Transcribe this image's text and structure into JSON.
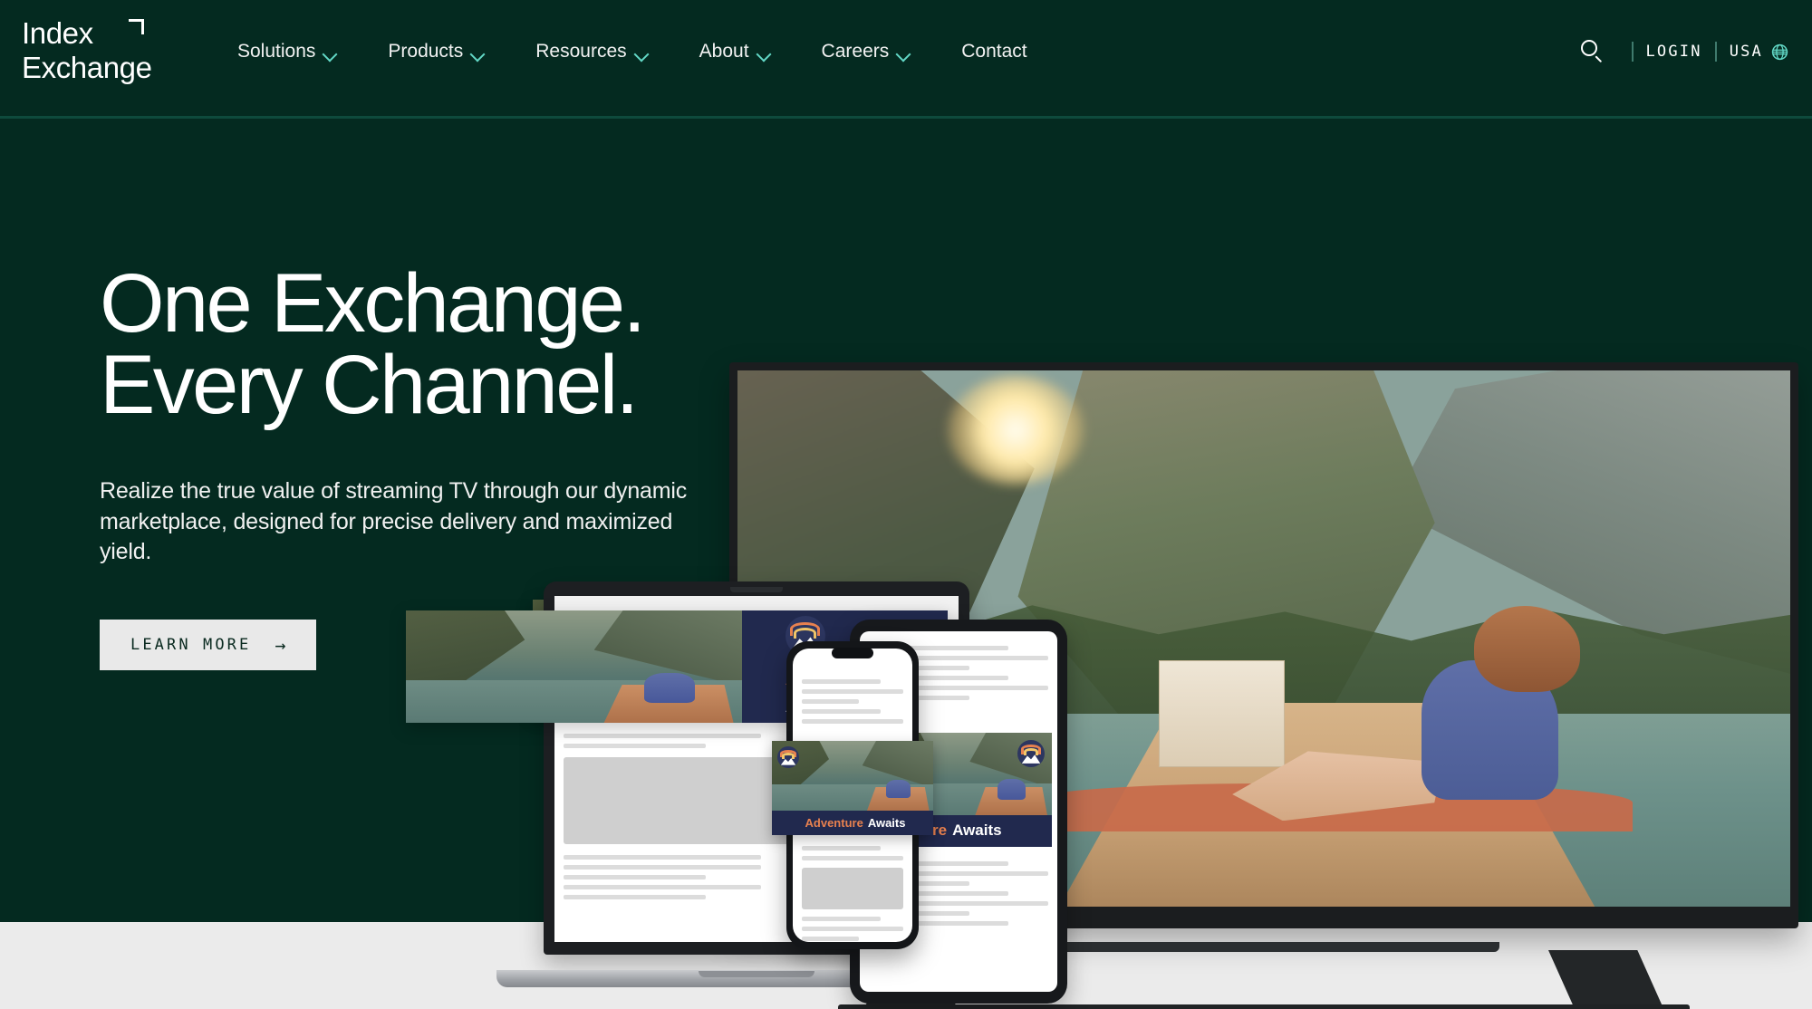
{
  "meta": {
    "brand_green": "#042a20",
    "accent_teal": "#62d8c6",
    "footer_gray": "#ebebeb",
    "ad_navy": "#21294e",
    "ad_orange": "#e8814f"
  },
  "header": {
    "logo": {
      "line1": "Index",
      "line2": "Exchange",
      "mark": "corner-bracket"
    },
    "nav": [
      {
        "label": "Solutions",
        "has_dropdown": true
      },
      {
        "label": "Products",
        "has_dropdown": true
      },
      {
        "label": "Resources",
        "has_dropdown": true
      },
      {
        "label": "About",
        "has_dropdown": true
      },
      {
        "label": "Careers",
        "has_dropdown": true
      },
      {
        "label": "Contact",
        "has_dropdown": false
      }
    ],
    "utility": {
      "search_icon": "search-icon",
      "login_label": "LOGIN",
      "locale_label": "USA",
      "globe_icon": "globe-icon",
      "divider": "|"
    }
  },
  "hero": {
    "headline_line1": "One Exchange.",
    "headline_line2": "Every Channel.",
    "subcopy": "Realize the true value of streaming TV through our dynamic marketplace, designed for precise delivery and maximized yield.",
    "cta_label": "LEARN MORE",
    "cta_arrow": "→"
  },
  "devices": {
    "tv": {
      "name": "television",
      "content": "Woman sitting in a longtail boat on a lake between jungle limestone cliffs with sun flare"
    },
    "laptop": {
      "name": "laptop",
      "content": "Web article page with display banner ad"
    },
    "tablet": {
      "name": "tablet",
      "content": "Web article page with square ad unit"
    },
    "phone": {
      "name": "smartphone",
      "content": "Mobile article page with ad unit"
    },
    "floating_banner": {
      "name": "floating-video-banner",
      "content": "Lake and cliffs scene"
    }
  },
  "ad_creative": {
    "headline_line1": "Adventure",
    "headline_line2": "Awaits",
    "logo": "rainbow-mountain-icon",
    "background": "#21294e",
    "line1_color": "#e8814f",
    "line2_color": "#ffffff"
  }
}
